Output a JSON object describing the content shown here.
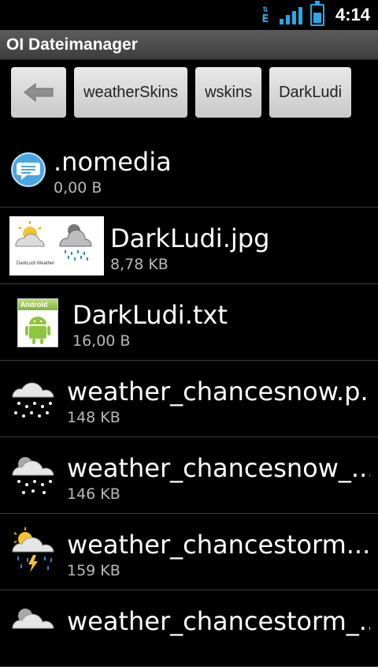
{
  "status_bar": {
    "time": "4:14",
    "network_type": "E",
    "network_icon": "edge-data-icon",
    "signal_icon": "signal-bars-icon",
    "battery_icon": "battery-icon",
    "accent_color": "#28a9e6"
  },
  "app": {
    "title": "OI Dateimanager"
  },
  "breadcrumbs": {
    "back_icon": "back-arrow-icon",
    "items": [
      {
        "label": "weatherSkins"
      },
      {
        "label": "wskins"
      },
      {
        "label": "DarkLudi"
      }
    ]
  },
  "files": [
    {
      "name": ".nomedia",
      "size": "0,00 B",
      "icon": "chat-bubble-icon"
    },
    {
      "name": "DarkLudi.jpg",
      "size": "8,78 KB",
      "icon": "image-thumbnail",
      "thumb_caption": "DarkLudi Weather"
    },
    {
      "name": "DarkLudi.txt",
      "size": "16,00 B",
      "icon": "android-text-icon",
      "icon_label": "Android"
    },
    {
      "name": "weather_chancesnow.p...",
      "size": "148 KB",
      "icon": "snow-cloud-icon"
    },
    {
      "name": "weather_chancesnow_...",
      "size": "146 KB",
      "icon": "sun-snow-cloud-icon"
    },
    {
      "name": "weather_chancestorm....",
      "size": "159 KB",
      "icon": "storm-cloud-icon"
    },
    {
      "name": "weather_chancestorm_...",
      "size": "",
      "icon": "storm-cloud-icon"
    }
  ]
}
